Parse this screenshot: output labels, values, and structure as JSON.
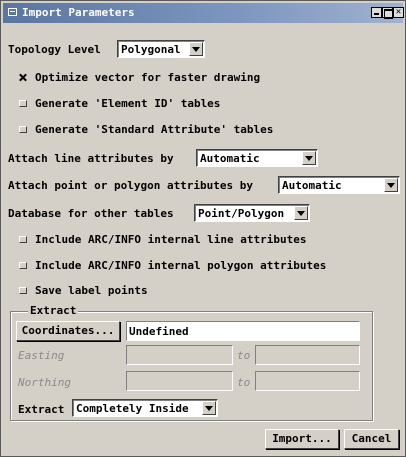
{
  "window": {
    "title": "Import Parameters"
  },
  "topology": {
    "label": "Topology Level",
    "value": "Polygonal"
  },
  "checkboxes": [
    {
      "label": "Optimize vector for faster drawing",
      "checked": true
    },
    {
      "label": "Generate 'Element ID' tables",
      "checked": false
    },
    {
      "label": "Generate 'Standard Attribute' tables",
      "checked": false
    }
  ],
  "attach_line": {
    "label": "Attach line attributes by",
    "value": "Automatic"
  },
  "attach_point": {
    "label": "Attach point or polygon attributes by",
    "value": "Automatic"
  },
  "database": {
    "label": "Database for other tables",
    "value": "Point/Polygon"
  },
  "checkboxes2": [
    {
      "label": "Include ARC/INFO internal line attributes",
      "checked": false
    },
    {
      "label": "Include ARC/INFO internal polygon attributes",
      "checked": false
    },
    {
      "label": "Save label points",
      "checked": false
    }
  ],
  "extract": {
    "group_label": "Extract",
    "coordinates_button": "Coordinates...",
    "coordinates_value": "Undefined",
    "easting_label": "Easting",
    "northing_label": "Northing",
    "to_label": "to",
    "extract_label": "Extract",
    "extract_value": "Completely Inside"
  },
  "buttons": {
    "import": "Import...",
    "cancel": "Cancel"
  }
}
